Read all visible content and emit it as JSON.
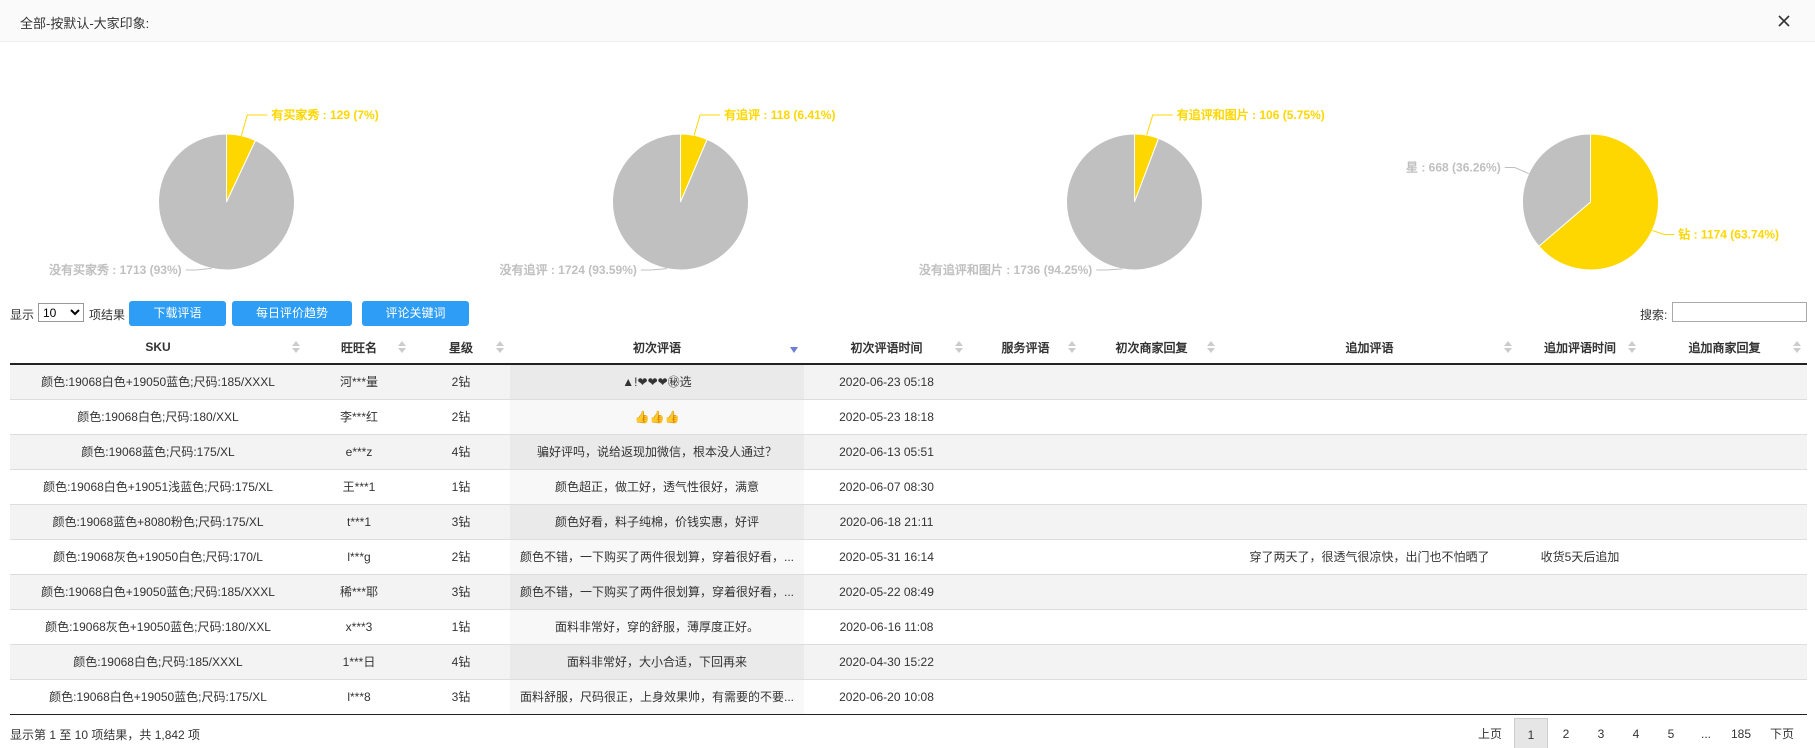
{
  "window": {
    "title": "全部-按默认-大家印象:"
  },
  "colors": {
    "highlight": "#FFD700",
    "neutral": "#C0C0C0",
    "button": "#2D9DF6"
  },
  "charts": [
    {
      "type": "pie",
      "slices": [
        {
          "label": "有买家秀",
          "value": 129,
          "percent": 7,
          "color": "#FFD700"
        },
        {
          "label": "没有买家秀",
          "value": 1713,
          "percent": 93,
          "color": "#C0C0C0"
        }
      ]
    },
    {
      "type": "pie",
      "slices": [
        {
          "label": "有追评",
          "value": 118,
          "percent": 6.41,
          "color": "#FFD700"
        },
        {
          "label": "没有追评",
          "value": 1724,
          "percent": 93.59,
          "color": "#C0C0C0"
        }
      ]
    },
    {
      "type": "pie",
      "slices": [
        {
          "label": "有追评和图片",
          "value": 106,
          "percent": 5.75,
          "color": "#FFD700"
        },
        {
          "label": "没有追评和图片",
          "value": 1736,
          "percent": 94.25,
          "color": "#C0C0C0"
        }
      ]
    },
    {
      "type": "pie",
      "slices": [
        {
          "label": "钻",
          "value": 1174,
          "percent": 63.74,
          "color": "#FFD700"
        },
        {
          "label": "星",
          "value": 668,
          "percent": 36.26,
          "color": "#C0C0C0"
        }
      ]
    }
  ],
  "chart_labels": [
    {
      "yes": "有买家秀 : 129 (7%)",
      "no": "没有买家秀 : 1713 (93%)"
    },
    {
      "yes": "有追评 : 118 (6.41%)",
      "no": "没有追评 : 1724 (93.59%)"
    },
    {
      "yes": "有追评和图片 : 106 (5.75%)",
      "no": "没有追评和图片 : 1736 (94.25%)"
    },
    {
      "yes": "钻 : 1174 (63.74%)",
      "no": "星 : 668 (36.26%)"
    }
  ],
  "toolbar": {
    "show_prefix": "显示",
    "page_size": "10",
    "show_suffix": "项结果",
    "download_label": "下载评语",
    "trend_label": "每日评价趋势",
    "keywords_label": "评论关键词",
    "search_label": "搜索:",
    "search_value": ""
  },
  "table": {
    "columns": [
      "SKU",
      "旺旺名",
      "星级",
      "初次评语",
      "初次评语时间",
      "服务评语",
      "初次商家回复",
      "追加评语",
      "追加评语时间",
      "追加商家回复"
    ],
    "rows": [
      [
        "颜色:19068白色+19050蓝色;尺码:185/XXXL",
        "河***量",
        "2钻",
        "▲!❤❤❤㊙选",
        "2020-06-23 05:18",
        "",
        "",
        "",
        "",
        ""
      ],
      [
        "颜色:19068白色;尺码:180/XXL",
        "李***红",
        "2钻",
        "👍👍👍",
        "2020-05-23 18:18",
        "",
        "",
        "",
        "",
        ""
      ],
      [
        "颜色:19068蓝色;尺码:175/XL",
        "e***z",
        "4钻",
        "骗好评吗，说给返现加微信，根本没人通过？",
        "2020-06-13 05:51",
        "",
        "",
        "",
        "",
        ""
      ],
      [
        "颜色:19068白色+19051浅蓝色;尺码:175/XL",
        "王***1",
        "1钻",
        "颜色超正，做工好，透气性很好，满意",
        "2020-06-07 08:30",
        "",
        "",
        "",
        "",
        ""
      ],
      [
        "颜色:19068蓝色+8080粉色;尺码:175/XL",
        "t***1",
        "3钻",
        "颜色好看，料子纯棉，价钱实惠，好评",
        "2020-06-18 21:11",
        "",
        "",
        "",
        "",
        ""
      ],
      [
        "颜色:19068灰色+19050白色;尺码:170/L",
        "l***g",
        "2钻",
        "颜色不错，一下购买了两件很划算，穿着很好看，...",
        "2020-05-31 16:14",
        "",
        "",
        "穿了两天了，很透气很凉快，出门也不怕晒了",
        "收货5天后追加",
        ""
      ],
      [
        "颜色:19068白色+19050蓝色;尺码:185/XXXL",
        "稀***耶",
        "3钻",
        "颜色不错，一下购买了两件很划算，穿着很好看，...",
        "2020-05-22 08:49",
        "",
        "",
        "",
        "",
        ""
      ],
      [
        "颜色:19068灰色+19050蓝色;尺码:180/XXL",
        "x***3",
        "1钻",
        "面料非常好，穿的舒服，薄厚度正好。",
        "2020-06-16 11:08",
        "",
        "",
        "",
        "",
        ""
      ],
      [
        "颜色:19068白色;尺码:185/XXXL",
        "1***日",
        "4钻",
        "面料非常好，大小合适，下回再来",
        "2020-04-30 15:22",
        "",
        "",
        "",
        "",
        ""
      ],
      [
        "颜色:19068白色+19050蓝色;尺码:175/XL",
        "l***8",
        "3钻",
        "面料舒服，尺码很正，上身效果帅，有需要的不要...",
        "2020-06-20 10:08",
        "",
        "",
        "",
        "",
        ""
      ]
    ]
  },
  "footer": {
    "info": "显示第 1 至 10 项结果，共 1,842 项"
  },
  "pagination": {
    "prev": "上页",
    "pages": [
      "1",
      "2",
      "3",
      "4",
      "5",
      "...",
      "185"
    ],
    "current": "1",
    "next": "下页"
  }
}
